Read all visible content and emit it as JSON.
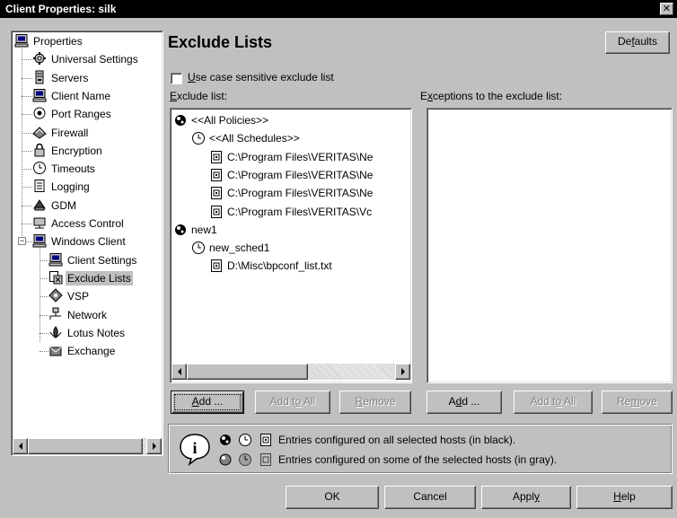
{
  "window": {
    "title": "Client Properties: silk",
    "close_glyph": "✕"
  },
  "tree": {
    "items": [
      {
        "label": "Properties",
        "icon": "computer-icon"
      },
      {
        "label": "Universal Settings",
        "icon": "settings-icon"
      },
      {
        "label": "Servers",
        "icon": "server-icon"
      },
      {
        "label": "Client Name",
        "icon": "computer-icon"
      },
      {
        "label": "Port Ranges",
        "icon": "port-icon"
      },
      {
        "label": "Firewall",
        "icon": "firewall-icon"
      },
      {
        "label": "Encryption",
        "icon": "lock-icon"
      },
      {
        "label": "Timeouts",
        "icon": "clock-icon"
      },
      {
        "label": "Logging",
        "icon": "log-icon"
      },
      {
        "label": "GDM",
        "icon": "gdm-icon"
      },
      {
        "label": "Access Control",
        "icon": "access-icon"
      },
      {
        "label": "Windows Client",
        "icon": "computer-icon"
      },
      {
        "label": "Client Settings",
        "icon": "computer-icon"
      },
      {
        "label": "Exclude Lists",
        "icon": "exclude-icon"
      },
      {
        "label": "VSP",
        "icon": "vsp-icon"
      },
      {
        "label": "Network",
        "icon": "network-icon"
      },
      {
        "label": "Lotus Notes",
        "icon": "lotus-icon"
      },
      {
        "label": "Exchange",
        "icon": "exchange-icon"
      }
    ],
    "expander_minus": "−"
  },
  "content": {
    "title": "Exclude Lists",
    "defaults_button": {
      "pre": "De",
      "u": "f",
      "post": "aults"
    },
    "case_sensitive": {
      "pre": "",
      "u": "U",
      "post": "se case sensitive exclude list",
      "checked": false
    },
    "exclude_label": {
      "pre": "",
      "u": "E",
      "post": "xclude list:"
    },
    "exceptions_label": {
      "pre": "E",
      "u": "x",
      "post": "ceptions to the exclude list:"
    },
    "exclude_items": [
      {
        "label": "<<All Policies>>",
        "icon": "policy-icon"
      },
      {
        "label": "<<All Schedules>>",
        "icon": "schedule-clock-icon"
      },
      {
        "label": "C:\\Program Files\\VERITAS\\Ne",
        "icon": "file-icon"
      },
      {
        "label": "C:\\Program Files\\VERITAS\\Ne",
        "icon": "file-icon"
      },
      {
        "label": "C:\\Program Files\\VERITAS\\Ne",
        "icon": "file-icon"
      },
      {
        "label": "C:\\Program Files\\VERITAS\\Vc",
        "icon": "file-icon"
      },
      {
        "label": "new1",
        "icon": "policy-icon"
      },
      {
        "label": "new_sched1",
        "icon": "schedule-clock-icon"
      },
      {
        "label": "D:\\Misc\\bpconf_list.txt",
        "icon": "file-icon"
      }
    ],
    "exclude_buttons": {
      "add": {
        "pre": "",
        "u": "A",
        "post": "dd ..."
      },
      "add_to_all": {
        "pre": "Add t",
        "u": "o",
        "post": " All"
      },
      "remove": {
        "pre": "",
        "u": "R",
        "post": "emove"
      }
    },
    "exception_buttons": {
      "add": {
        "pre": "A",
        "u": "d",
        "post": "d ..."
      },
      "add_to_all": {
        "pre": "Add t",
        "u": "o",
        "post": " All"
      },
      "remove": {
        "pre": "Re",
        "u": "m",
        "post": "ove"
      }
    },
    "legend": {
      "line1": "Entries configured on all selected hosts (in black).",
      "line2": "Entries configured on some of the selected hosts (in gray).",
      "info_glyph": "i"
    }
  },
  "footer": {
    "ok": "OK",
    "cancel": "Cancel",
    "apply": {
      "pre": "Appl",
      "u": "y",
      "post": ""
    },
    "help": {
      "pre": "",
      "u": "H",
      "post": "elp"
    }
  }
}
